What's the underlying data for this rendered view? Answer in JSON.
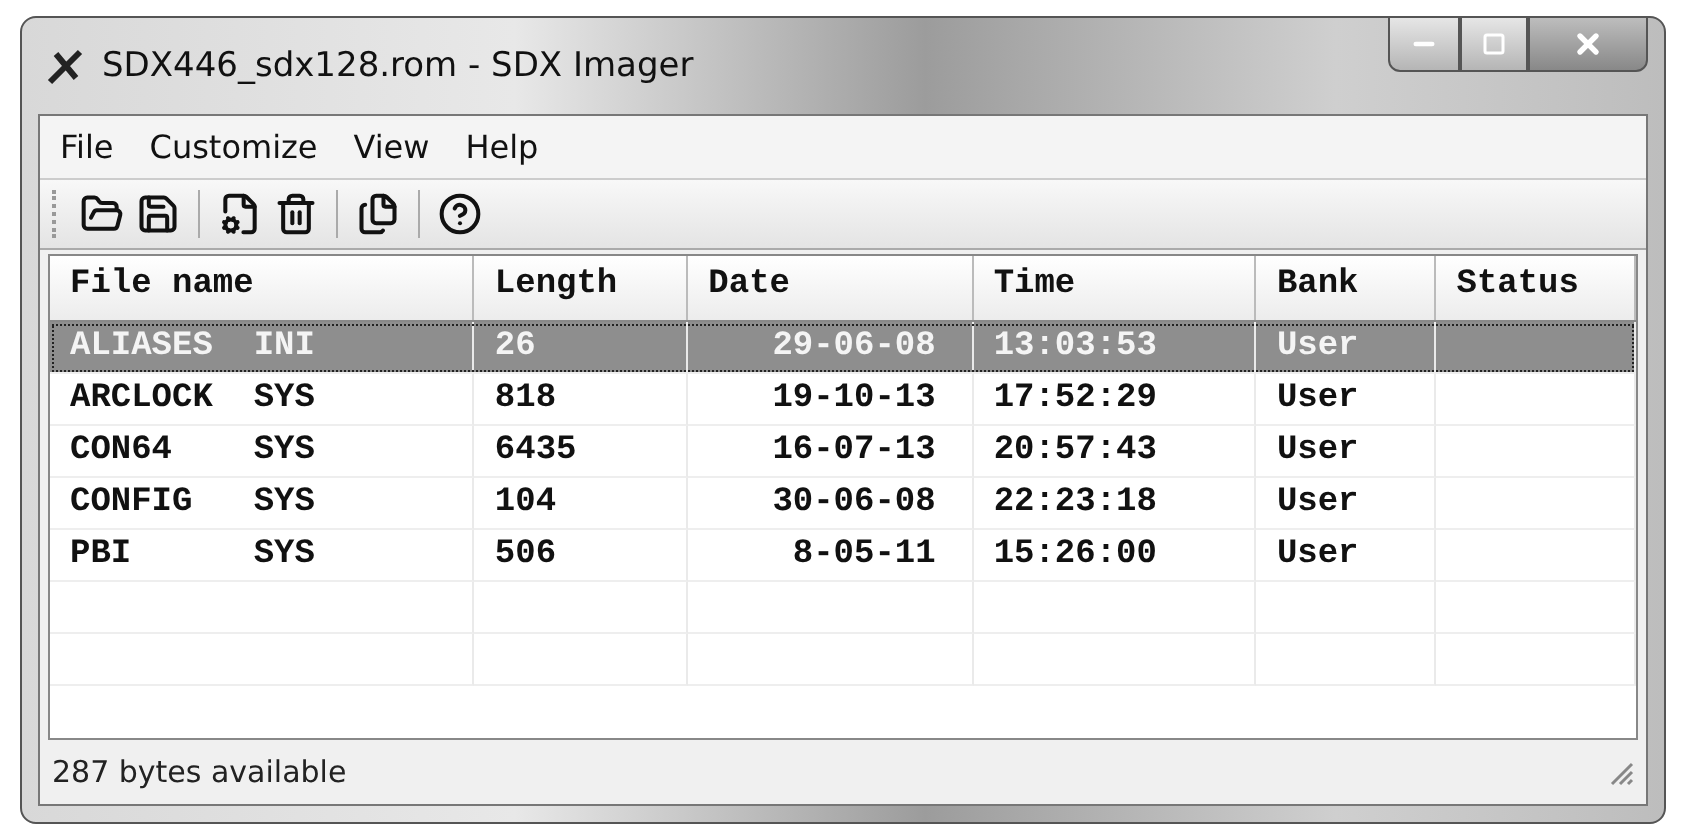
{
  "window": {
    "title": "SDX446_sdx128.rom - SDX Imager"
  },
  "menu": [
    "File",
    "Customize",
    "View",
    "Help"
  ],
  "table": {
    "columns": [
      "File name",
      "Length",
      "Date",
      "Time",
      "Bank",
      "Status"
    ],
    "rows": [
      {
        "file_name": "ALIASES  INI",
        "length": "26",
        "date": "29-06-08",
        "time": "13:03:53",
        "bank": "User",
        "selected": true
      },
      {
        "file_name": "ARCLOCK  SYS",
        "length": "818",
        "date": "19-10-13",
        "time": "17:52:29",
        "bank": "User",
        "selected": false
      },
      {
        "file_name": "CON64    SYS",
        "length": "6435",
        "date": "16-07-13",
        "time": "20:57:43",
        "bank": "User",
        "selected": false
      },
      {
        "file_name": "CONFIG   SYS",
        "length": "104",
        "date": "30-06-08",
        "time": "22:23:18",
        "bank": "User",
        "selected": false
      },
      {
        "file_name": "PBI      SYS",
        "length": "506",
        "date": "8-05-11",
        "time": "15:26:00",
        "bank": "User",
        "selected": false
      }
    ]
  },
  "status_bar": "287 bytes available"
}
